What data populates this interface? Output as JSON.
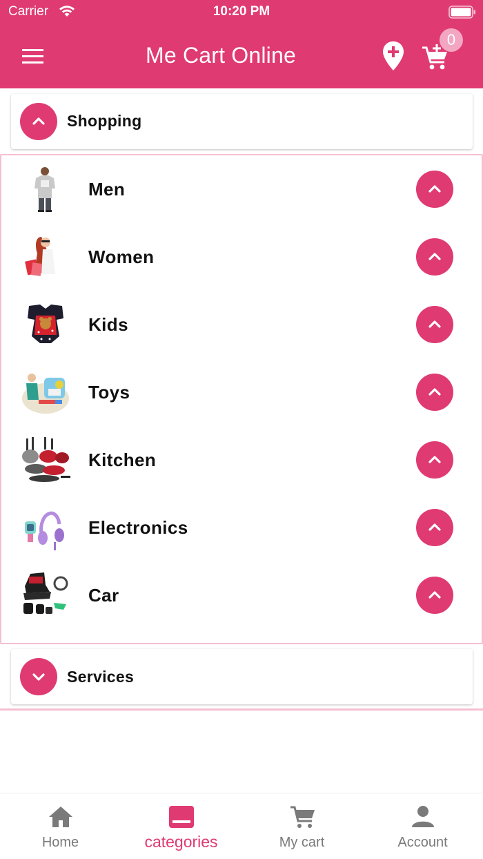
{
  "status_bar": {
    "carrier": "Carrier",
    "time": "10:20 PM"
  },
  "header": {
    "title": "Me Cart Online",
    "cart_count": "0"
  },
  "shopping": {
    "title": "Shopping",
    "expanded": true,
    "items": [
      {
        "label": "Men",
        "icon": "men-tshirt-thumb"
      },
      {
        "label": "Women",
        "icon": "women-shopping-thumb"
      },
      {
        "label": "Kids",
        "icon": "kids-outfit-thumb"
      },
      {
        "label": "Toys",
        "icon": "toys-playset-thumb"
      },
      {
        "label": "Kitchen",
        "icon": "cookware-set-thumb"
      },
      {
        "label": "Electronics",
        "icon": "headphones-thumb"
      },
      {
        "label": "Car",
        "icon": "car-seat-thumb"
      }
    ]
  },
  "services": {
    "title": "Services",
    "expanded": false
  },
  "bottom_nav": {
    "items": [
      {
        "label": "Home",
        "icon": "home-icon",
        "active": false
      },
      {
        "label": "categories",
        "icon": "categories-icon",
        "active": true
      },
      {
        "label": "My cart",
        "icon": "cart-icon",
        "active": false
      },
      {
        "label": "Account",
        "icon": "account-icon",
        "active": false
      }
    ]
  },
  "colors": {
    "accent": "#e03a72",
    "badge": "#f3a6c2",
    "panel_border": "#f4bfd2",
    "inactive": "#7a7a7a"
  }
}
